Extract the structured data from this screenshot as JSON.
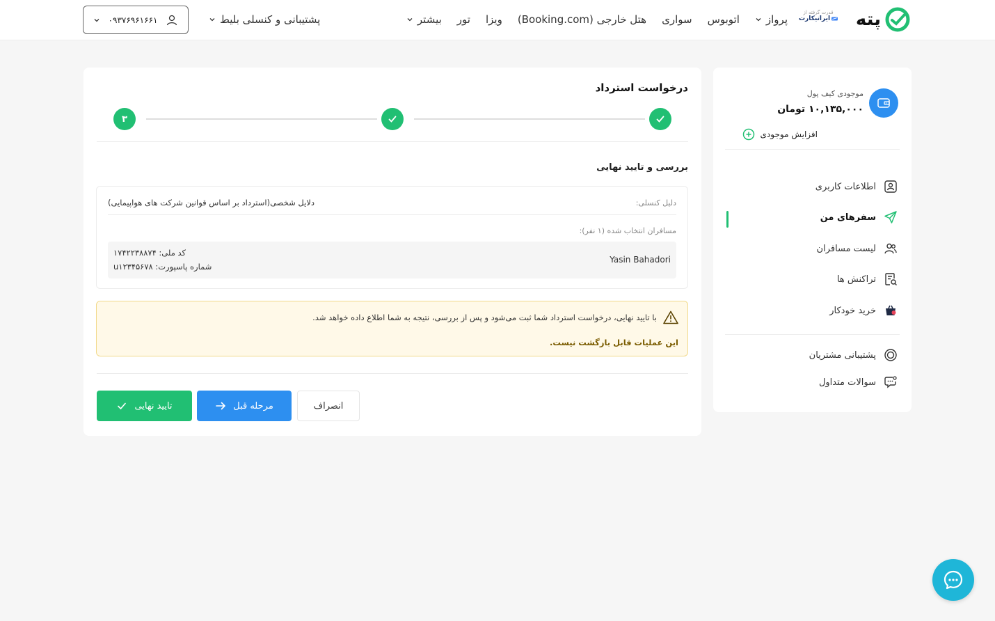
{
  "header": {
    "logo_text": "پته",
    "partner": {
      "sub": "قدرت گرفته از",
      "name": "ایرانیکارت"
    },
    "nav": [
      {
        "label": "پرواز",
        "has_dropdown": true
      },
      {
        "label": "اتوبوس",
        "has_dropdown": false
      },
      {
        "label": "سواری",
        "has_dropdown": false
      },
      {
        "label": "هتل خارجی (Booking.com)",
        "has_dropdown": false
      },
      {
        "label": "ویزا",
        "has_dropdown": false
      },
      {
        "label": "تور",
        "has_dropdown": false
      },
      {
        "label": "بیشتر",
        "has_dropdown": true
      }
    ],
    "support_label": "پشتیبانی و کنسلی بلیط",
    "user_phone": "۰۹۳۷۶۹۶۱۶۶۱"
  },
  "sidebar": {
    "wallet_label": "موجودی کیف پول",
    "wallet_balance": "۱۰,۱۳۵,۰۰۰ تومان",
    "add_balance": "افزایش موجودی",
    "menu": [
      {
        "label": "اطلاعات کاربری",
        "icon": "user-id-icon"
      },
      {
        "label": "سفرهای من",
        "icon": "paper-plane-icon",
        "active": true
      },
      {
        "label": "لیست مسافران",
        "icon": "users-icon"
      },
      {
        "label": "تراکنش ها",
        "icon": "receipt-search-icon"
      },
      {
        "label": "خرید خودکار",
        "icon": "auto-buy-icon"
      }
    ],
    "support_menu": [
      {
        "label": "پشتیبانی مشتریان",
        "icon": "support-icon"
      },
      {
        "label": "سوالات متداول",
        "icon": "faq-chat-icon"
      }
    ]
  },
  "main": {
    "title": "درخواست استرداد",
    "steps": [
      "✓",
      "✓",
      "۳"
    ],
    "section_title": "بررسی و تایید نهایی",
    "reason_label": "دلیل کنسلی:",
    "reason_value": "دلایل شخصی(استرداد بر اساس قوانین شرکت های هواپیمایی)",
    "passengers_label": "مسافران انتخاب شده (۱ نفر):",
    "passenger": {
      "name": "Yasin Bahadori",
      "national_id": "کد ملی: ۱۷۴۲۲۳۸۸۷۴",
      "passport": "شماره پاسپورت: u۱۲۳۴۵۶۷۸"
    },
    "warning_text": "با تایید نهایی، درخواست استرداد شما ثبت می‌شود و پس از بررسی، نتیجه به شما اطلاع داده خواهد شد.",
    "warning_note": "این عملیات قابل بازگشت نیست.",
    "buttons": {
      "confirm": "تایید نهایی",
      "prev": "مرحله قبل",
      "cancel": "انصراف"
    }
  },
  "colors": {
    "primary_green": "#21bf73",
    "primary_blue": "#2d8ff0",
    "chat": "#1fb6d8",
    "warning_bg": "#fff9e8"
  }
}
